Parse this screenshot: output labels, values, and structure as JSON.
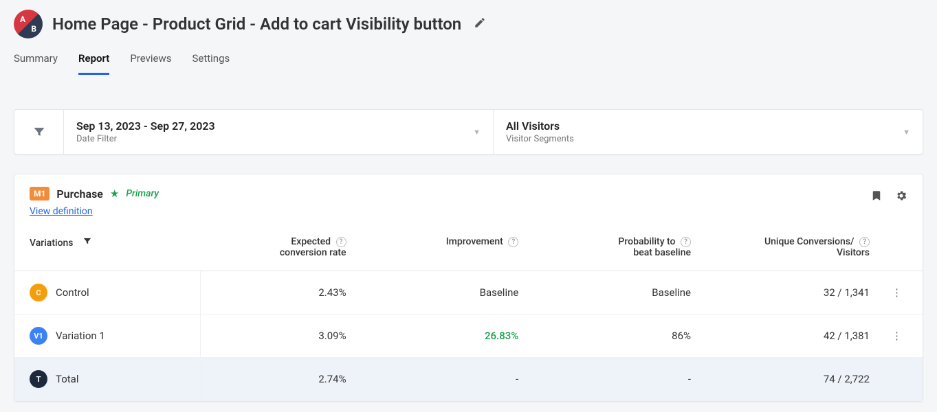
{
  "header": {
    "page_title": "Home Page - Product Grid - Add to cart Visibility button"
  },
  "tabs": {
    "summary": "Summary",
    "report": "Report",
    "previews": "Previews",
    "settings": "Settings"
  },
  "filters": {
    "date_value": "Sep 13, 2023 - Sep 27, 2023",
    "date_label": "Date Filter",
    "segment_value": "All Visitors",
    "segment_label": "Visitor Segments"
  },
  "metric": {
    "badge": "M1",
    "name": "Purchase",
    "primary_label": "Primary",
    "view_definition": "View definition"
  },
  "columns": {
    "variations": "Variations",
    "expected_top": "Expected",
    "expected_bottom": "conversion rate",
    "improvement": "Improvement",
    "prob_top": "Probability to",
    "prob_bottom": "beat baseline",
    "conv_top": "Unique Conversions/",
    "conv_bottom": "Visitors"
  },
  "rows": {
    "control": {
      "name": "Control",
      "rate": "2.43%",
      "improvement": "Baseline",
      "probability": "Baseline",
      "conversions": "32 / 1,341"
    },
    "v1": {
      "name": "Variation 1",
      "rate": "3.09%",
      "improvement": "26.83%",
      "probability": "86%",
      "conversions": "42 / 1,381"
    },
    "total": {
      "name": "Total",
      "rate": "2.74%",
      "improvement": "-",
      "probability": "-",
      "conversions": "74 / 2,722"
    }
  }
}
